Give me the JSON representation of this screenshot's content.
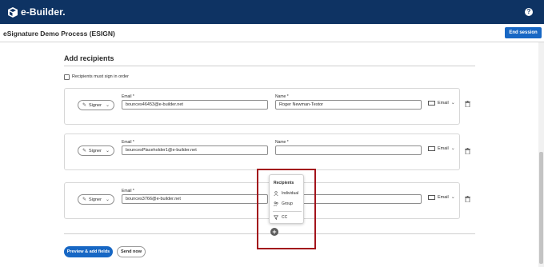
{
  "app": {
    "logo_text": "e-Builder."
  },
  "header": {
    "title": "eSignature Demo Process (ESIGN)",
    "end_session_label": "End session",
    "help_glyph": "?"
  },
  "section": {
    "title": "Add recipients",
    "sign_in_order_label": "Recipients must sign in order",
    "sign_in_order_checked": false
  },
  "labels": {
    "email": "Email",
    "name": "Name",
    "required_marker": "*"
  },
  "recipients": [
    {
      "role": "Signer",
      "email": "bounces46453@e-builder.net",
      "name": "Roger Newman-Testor",
      "delivery": "Email"
    },
    {
      "role": "Signer",
      "email": "bouncesPlaceholder1@e-builder.net",
      "name": "",
      "delivery": "Email"
    },
    {
      "role": "Signer",
      "email": "bounces3766@e-builder.net",
      "name": "",
      "delivery": "Email"
    }
  ],
  "add_menu": {
    "title": "Recipients",
    "items": [
      {
        "label": "Individual",
        "icon": "person-icon"
      },
      {
        "label": "Group",
        "icon": "group-icon"
      },
      {
        "label": "CC",
        "icon": "cc-icon"
      }
    ],
    "add_glyph": "+"
  },
  "footer": {
    "preview_label": "Preview & add fields",
    "send_label": "Send now"
  },
  "colors": {
    "topbar": "#0e3363",
    "primary": "#1767c4",
    "highlight": "#a3141c"
  }
}
